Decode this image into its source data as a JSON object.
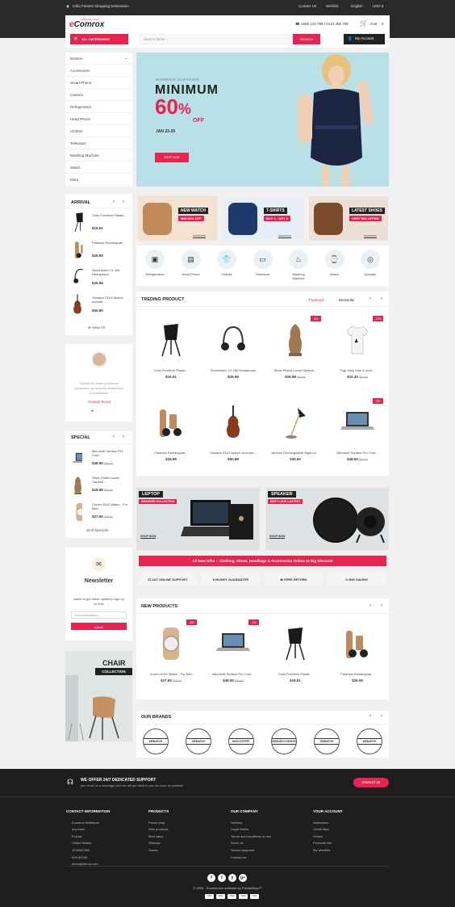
{
  "topbar": {
    "tagline": "India Fastest Shopping Destination",
    "contact": "Contact Us",
    "wishlist": "Wishlist",
    "language": "English",
    "currency": "USD $"
  },
  "header": {
    "logo_prefix": "e",
    "logo_main": "Comrox",
    "logo_tagline": "Online Buy Shop",
    "phone": "1800 123 789 / 0123 456 789",
    "cart": "Cart",
    "cart_count": "0",
    "all_categories": "ALL CATEGORIES",
    "search_placeholder": "Search items...",
    "search_button": "SEARCH",
    "my_account": "My Account"
  },
  "sidebar": {
    "items": [
      "Women",
      "Accessories",
      "Smart Phone",
      "Camera",
      "Refrigerators",
      "Head Phone",
      "Clothes",
      "Television",
      "Washing Machine",
      "Watch",
      "More"
    ]
  },
  "hero": {
    "eyebrow": "WOMEN'S CLOTHING",
    "title": "MINIMUM",
    "discount": "60",
    "pct": "%",
    "off": "OFF",
    "date": "JAN 23-26",
    "button": "SHOP NOW"
  },
  "arrival": {
    "title": "ARRIVAL",
    "items": [
      {
        "name": "Cello Furniture Plastic...",
        "price": "$16.51"
      },
      {
        "name": "Fastrack Rectangular...",
        "price": "$26.99"
      },
      {
        "name": "Sennheiser CX 180 Headphone",
        "price": "$25.99"
      },
      {
        "name": "Yamaha F310 Spruce Acousti...",
        "price": "$50.99"
      }
    ],
    "view_all": "View All"
  },
  "testimonial": {
    "text": "Claritas est etiam processus dynamicus, qui sequitur mutationem consuetudium",
    "name": "-Grande Bcom"
  },
  "special": {
    "title": "SPECIAL",
    "items": [
      {
        "name": "Microsoft Surface Pro Core...",
        "price": "$48.50",
        "old": "$50.00"
      },
      {
        "name": "Silver Plated Laxmi Ganesh...",
        "price": "$28.98",
        "old": "$30.50"
      },
      {
        "name": "Curren 8192 Watch - For Men",
        "price": "$27.60",
        "old": "$30.00"
      }
    ],
    "view_all": "All Specials"
  },
  "newsletter": {
    "title": "Newsletter",
    "text": "wants to get latest updates! sign up for free",
    "placeholder": "Your email address",
    "button": "submit"
  },
  "chair_banner": {
    "title": "CHAIR",
    "sub": "COLLECTION"
  },
  "promo": [
    {
      "title": "NEW WATCH",
      "sub": "MIN.50% OFF",
      "link": "SHOPNOW"
    },
    {
      "title": "T-SHIRTS",
      "sub": "BUY 1 - GET 2",
      "link": "SHOPNOW"
    },
    {
      "title": "LATEST SHOES",
      "sub": "VERY BIG OFFER",
      "link": "SHOPNOW"
    }
  ],
  "categories": [
    "Refrigerators",
    "Head Phone",
    "Clothes",
    "Television",
    "Washing Machine",
    "Watch",
    "Speaker"
  ],
  "trending": {
    "title": "TREDING PRODUCT",
    "tab1": "Featured",
    "tab2": "Bestseller",
    "products": [
      {
        "name": "Cello Furniture Plastic...",
        "price": "$16.51",
        "old": "",
        "badge": ""
      },
      {
        "name": "Sennheiser CX 180 Headphone",
        "price": "$25.99",
        "old": "",
        "badge": ""
      },
      {
        "name": "Silver Plated Laxmi Ganesh...",
        "price": "$28.98",
        "old": "$30.50",
        "badge": "-5%"
      },
      {
        "name": "Trigr Solid Men V-neck...",
        "price": "$16.40",
        "old": "$20.50",
        "badge": "-20%"
      },
      {
        "name": "Fastrack Rectangular...",
        "price": "$26.99",
        "old": "",
        "badge": ""
      },
      {
        "name": "Yamaha F310 Spruce Acoustic...",
        "price": "$50.99",
        "old": "",
        "badge": ""
      },
      {
        "name": "Aimrow Rechargeable Night Le...",
        "price": "$30.50",
        "old": "",
        "badge": ""
      },
      {
        "name": "Microsoft Surface Pro Core...",
        "price": "$48.50",
        "old": "$50.00",
        "badge": "-5%"
      }
    ]
  },
  "banners": [
    {
      "title": "LEPTOP",
      "sub": "BRANDED COLLECTION",
      "link": "SHOP NOW"
    },
    {
      "title": "SPEAKER",
      "sub": "BEST LOOK LASTEST",
      "link": "SHOP NOW"
    }
  ],
  "offer_strip": "All New Offer :- Clothing, Shoes, Headbags & Accessories Online At Big Discount",
  "services": [
    "24/7 ONLINE SUPPORT",
    "MONEY GUARANTEE",
    "FREE RETURN",
    "BIG SAVING"
  ],
  "new_products": {
    "title": "NEW PRODUCTS",
    "products": [
      {
        "name": "Curren 8192 Watch - For Men",
        "price": "$27.60",
        "old": "$30.00",
        "badge": "-8%"
      },
      {
        "name": "Microsoft Surface Pro Core...",
        "price": "$48.50",
        "old": "$50.00",
        "badge": "-3%"
      },
      {
        "name": "Cello Furniture Plastic...",
        "price": "$16.51",
        "old": "",
        "badge": ""
      },
      {
        "name": "Fastrack Rectangular...",
        "price": "$26.99",
        "old": "",
        "badge": ""
      }
    ]
  },
  "brands": {
    "title": "OUR BRANDS",
    "logos": [
      "WEBARCH",
      "WEBARCH",
      "MODI EXPERT",
      "WEBARCH DESIGN",
      "WEBARCH",
      "WEBARCH"
    ]
  },
  "support": {
    "title": "WE OFFER 24/7 DEDICATED SUPPORT",
    "sub": "you send us a message and we will get back to you as soon as possible",
    "button": "CONTACT US"
  },
  "footer": {
    "contact": {
      "title": "CONTACT INFORMATION",
      "lines": [
        "Ecomrox Multistore",
        "any town",
        "Florida",
        "United States",
        "1234567890",
        "626-54785",
        "demo@demo.com"
      ]
    },
    "products": {
      "title": "PRODUCTS",
      "lines": [
        "Prices drop",
        "New products",
        "Best sales",
        "Sitemap",
        "Stores"
      ]
    },
    "company": {
      "title": "OUR COMPANY",
      "lines": [
        "Delivery",
        "Legal Notice",
        "Terms and conditions of use",
        "About us",
        "Secure payment",
        "Contact us"
      ]
    },
    "account": {
      "title": "YOUR ACCOUNT",
      "lines": [
        "Addresses",
        "Credit slips",
        "Orders",
        "Personal info",
        "My wishlists"
      ]
    },
    "copyright": "© 2018 - Ecommerce software by PrestaShop™",
    "social": [
      "f",
      "t",
      "y",
      "g+"
    ],
    "payments": [
      "VISA",
      "VISA",
      "VISA",
      "VISA",
      "VISA"
    ]
  },
  "colors": {
    "accent": "#e8234f",
    "dark": "#2a2a2a"
  }
}
